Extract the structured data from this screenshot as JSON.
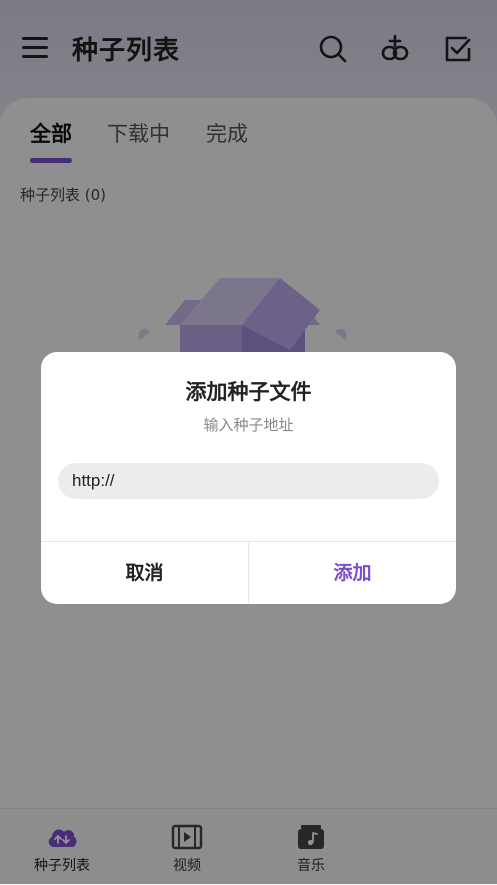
{
  "header": {
    "title": "种子列表",
    "icons": [
      "menu-icon",
      "search-icon",
      "add-link-icon",
      "checklist-icon"
    ]
  },
  "tabs": [
    {
      "label": "全部",
      "active": true
    },
    {
      "label": "下载中",
      "active": false
    },
    {
      "label": "完成",
      "active": false
    }
  ],
  "list": {
    "label": "种子列表 (0)"
  },
  "bottom_nav": [
    {
      "label": "种子列表",
      "icon": "cloud-transfer-icon",
      "active": true
    },
    {
      "label": "视频",
      "icon": "film-icon",
      "active": false
    },
    {
      "label": "音乐",
      "icon": "music-note-icon",
      "active": false
    }
  ],
  "dialog": {
    "title": "添加种子文件",
    "subtitle": "输入种子地址",
    "input_value": "http://",
    "cancel_label": "取消",
    "confirm_label": "添加"
  },
  "colors": {
    "accent": "#7b4ccf",
    "overlay": "rgba(0,0,0,0.42)"
  }
}
